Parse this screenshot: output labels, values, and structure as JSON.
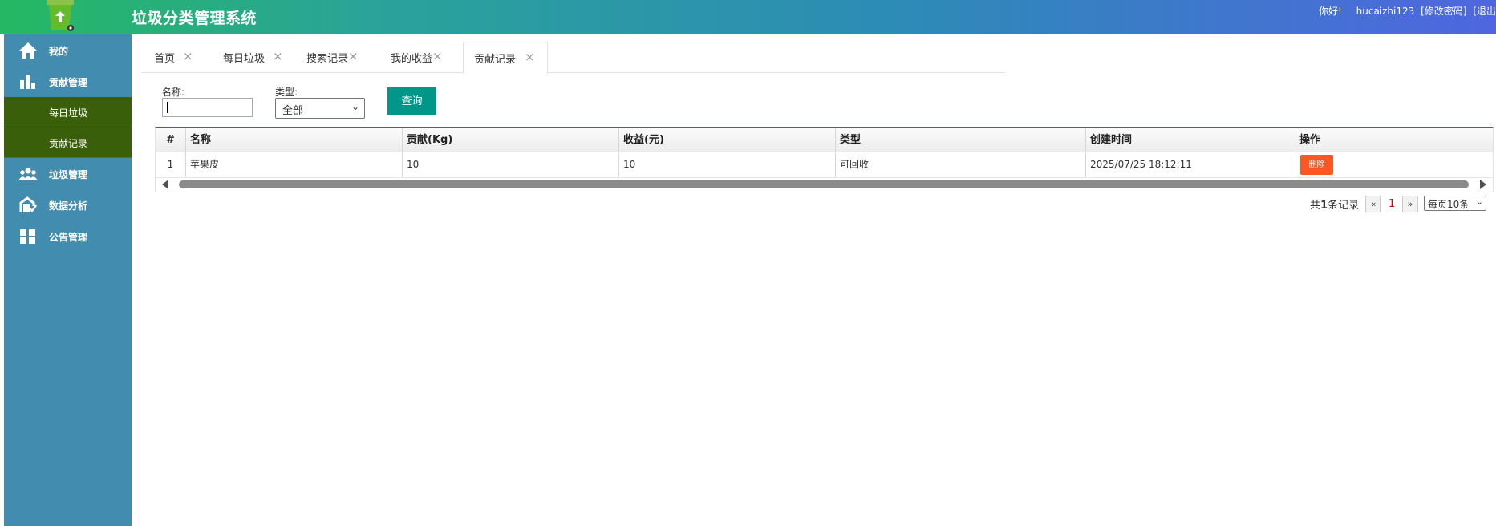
{
  "header": {
    "title": "垃圾分类管理系统",
    "greeting": "你好!",
    "username": "hucaizhi123",
    "change_password": "[修改密码]",
    "logout": "[退出"
  },
  "sidebar": {
    "items": [
      {
        "label": "我的",
        "icon": "home-icon"
      },
      {
        "label": "贡献管理",
        "icon": "bar-chart-icon"
      },
      {
        "label": "每日垃圾"
      },
      {
        "label": "贡献记录"
      },
      {
        "label": "垃圾管理",
        "icon": "users-icon"
      },
      {
        "label": "数据分析",
        "icon": "data-analysis-icon"
      },
      {
        "label": "公告管理",
        "icon": "grid-icon"
      }
    ]
  },
  "tabs": [
    {
      "label": "首页"
    },
    {
      "label": "每日垃圾"
    },
    {
      "label": "搜索记录"
    },
    {
      "label": "我的收益"
    },
    {
      "label": "贡献记录",
      "active": true
    }
  ],
  "filters": {
    "name_label": "名称:",
    "name_value": "",
    "type_label": "类型:",
    "type_value": "全部",
    "query_button": "查询"
  },
  "table": {
    "columns": [
      "#",
      "名称",
      "贡献(Kg)",
      "收益(元)",
      "类型",
      "创建时间",
      "操作"
    ],
    "rows": [
      {
        "index": "1",
        "name": "苹果皮",
        "contribution": "10",
        "income": "10",
        "type": "可回收",
        "created": "2025/07/25 18:12:11",
        "action": "删除"
      }
    ]
  },
  "pager": {
    "total_prefix": "共",
    "total_count": "1",
    "total_suffix": "条记录",
    "prev": "«",
    "current": "1",
    "next": "»",
    "page_size": "每页10条"
  },
  "colors": {
    "sidebar": "#428daf",
    "sidebar_sub": "#3a5f0b",
    "primary_button": "#009688",
    "danger_button": "#ff5722",
    "table_top_border": "#cc2d2d"
  }
}
